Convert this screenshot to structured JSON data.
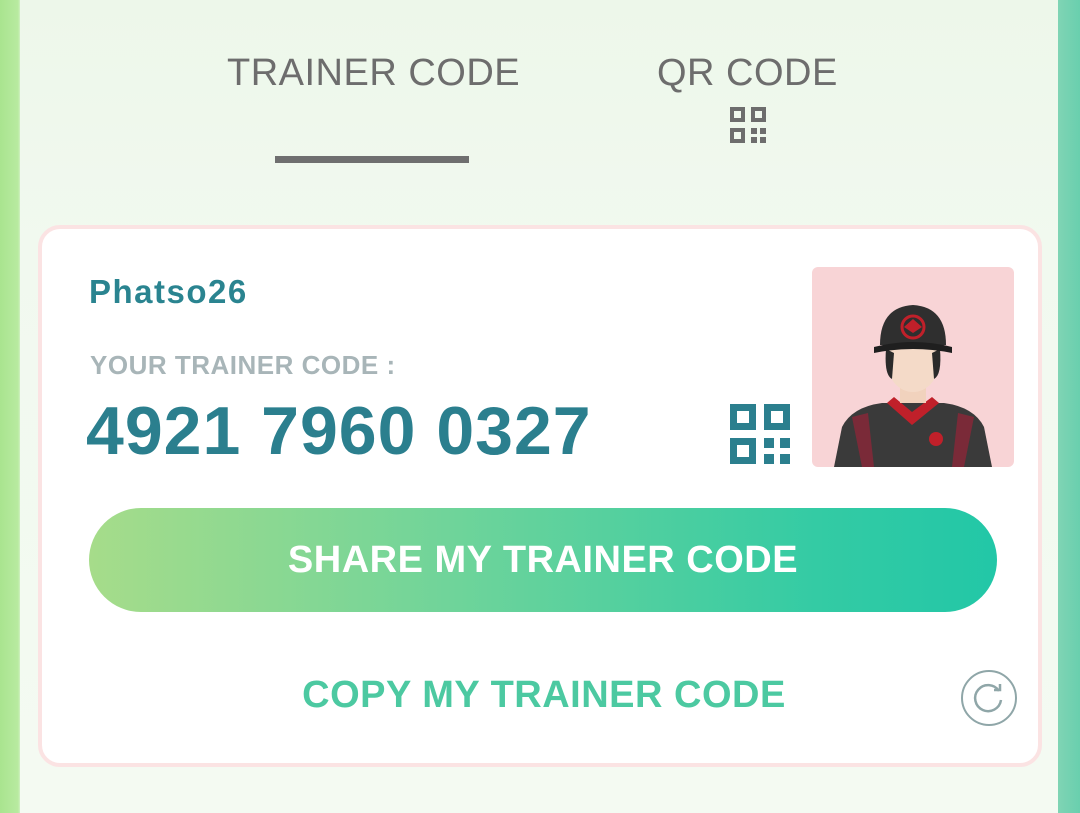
{
  "tabs": [
    {
      "label": "TRAINER CODE",
      "active": true
    },
    {
      "label": "QR CODE",
      "icon": "qr-code-icon",
      "active": false
    }
  ],
  "card": {
    "username": "Phatso26",
    "code_label": "YOUR TRAINER CODE :",
    "code_value": "4921 7960 0327",
    "qr_icon": "qr-code-icon",
    "share_button_label": "SHARE MY TRAINER CODE",
    "copy_link_label": "COPY MY TRAINER CODE",
    "refresh_icon": "refresh-icon"
  },
  "colors": {
    "accent_teal": "#2b7f8e",
    "button_gradient_start": "#a6dc8a",
    "button_gradient_end": "#22c7a7",
    "copy_link": "#4cc9a1",
    "avatar_bg": "#f8d4d6"
  }
}
